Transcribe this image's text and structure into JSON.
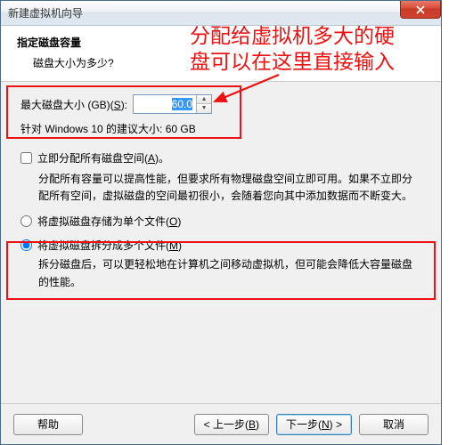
{
  "window": {
    "title": "新建虚拟机向导"
  },
  "header": {
    "title": "指定磁盘容量",
    "subtitle": "磁盘大小为多少?"
  },
  "disk": {
    "label_prefix": "最大磁盘大小 (GB)(",
    "label_key": "S",
    "label_suffix": "):",
    "value": "60.0",
    "recommend": "针对 Windows 10 的建议大小: 60 GB"
  },
  "allocate": {
    "label_prefix": "立即分配所有磁盘空间(",
    "label_key": "A",
    "label_suffix": ")。",
    "desc": "分配所有容量可以提高性能，但要求所有物理磁盘空间立即可用。如果不立即分配所有空间，虚拟磁盘的空间最初很小，会随着您向其中添加数据而不断变大。"
  },
  "radio1": {
    "label_prefix": "将虚拟磁盘存储为单个文件(",
    "label_key": "O",
    "label_suffix": ")"
  },
  "radio2": {
    "label_prefix": "将虚拟磁盘拆分成多个文件(",
    "label_key": "M",
    "label_suffix": ")",
    "desc": "拆分磁盘后，可以更轻松地在计算机之间移动虚拟机，但可能会降低大容量磁盘的性能。"
  },
  "buttons": {
    "help": "帮助",
    "back_prefix": "< 上一步(",
    "back_key": "B",
    "back_suffix": ")",
    "next_prefix": "下一步(",
    "next_key": "N",
    "next_suffix": ") >",
    "cancel": "取消"
  },
  "annotation": {
    "line1": "分配给虚拟机多大的硬",
    "line2": "盘可以在这里直接输入"
  }
}
